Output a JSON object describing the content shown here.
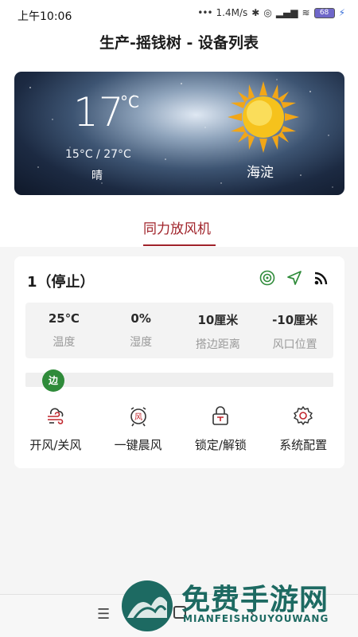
{
  "status_bar": {
    "time": "上午10:06",
    "network_speed": "1.4M/s",
    "battery": "68"
  },
  "header": {
    "title": "生产-摇钱树 - 设备列表"
  },
  "weather": {
    "temperature": "17",
    "unit": "°C",
    "range": "15°C / 27°C",
    "description": "晴",
    "location": "海淀",
    "icon": "sun-icon"
  },
  "tabs": [
    {
      "label": "同力放风机",
      "active": true
    }
  ],
  "device": {
    "title": "1（停止）",
    "status_icons": [
      "target-icon",
      "send-icon",
      "signal-icon"
    ],
    "stats": [
      {
        "value": "25℃",
        "label": "温度"
      },
      {
        "value": "0%",
        "label": "湿度"
      },
      {
        "value": "10厘米",
        "label": "搭边距离"
      },
      {
        "value": "-10厘米",
        "label": "风口位置"
      }
    ],
    "slider_label": "边",
    "actions": [
      {
        "label": "开风/关风",
        "icon": "wind-icon"
      },
      {
        "label": "一键晨风",
        "icon": "alarm-wind-icon"
      },
      {
        "label": "锁定/解锁",
        "icon": "lock-icon"
      },
      {
        "label": "系统配置",
        "icon": "gear-icon"
      }
    ]
  },
  "watermark": {
    "title": "免费手游网",
    "subtitle": "MIANFEISHOUYOUWANG"
  },
  "colors": {
    "accent": "#a0232a",
    "badge": "#2f8b3a",
    "icon_green": "#2f8b3a"
  }
}
